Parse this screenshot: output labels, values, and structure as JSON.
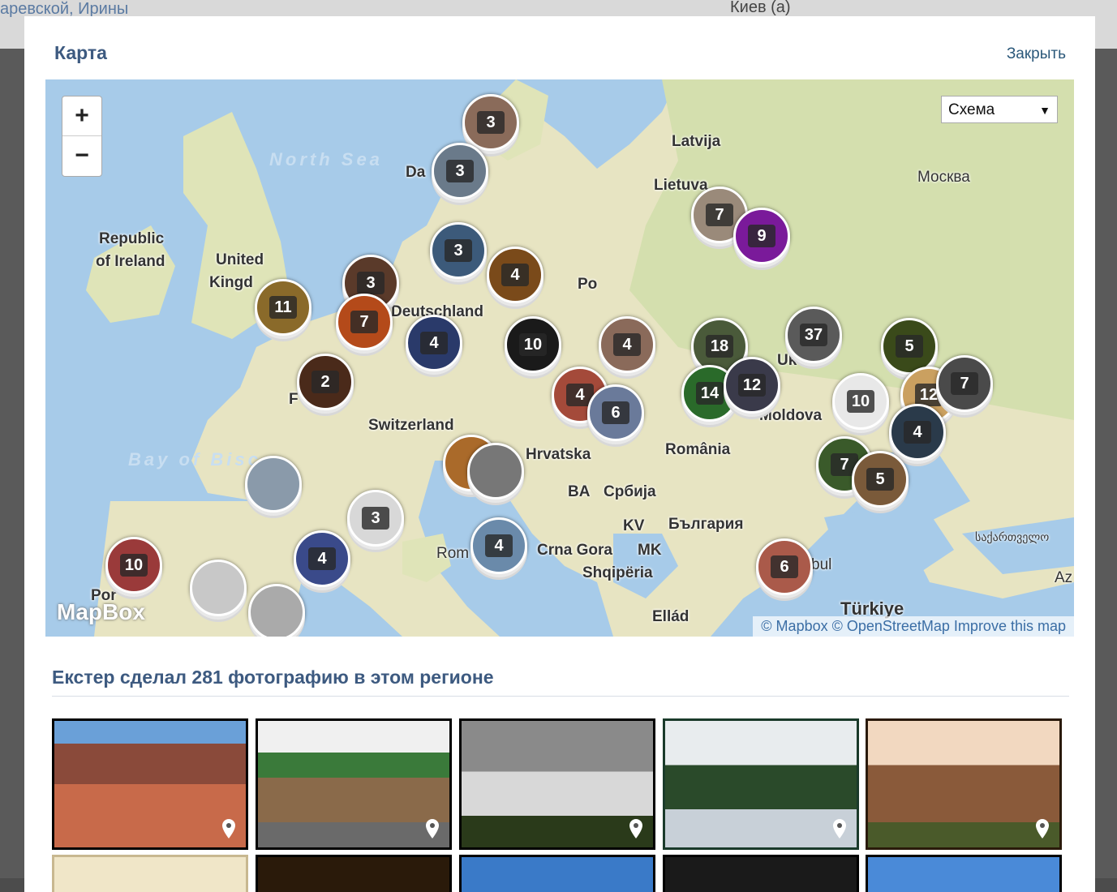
{
  "background": {
    "left_text": "аревской, Ирины",
    "right_text": "Киев (а)"
  },
  "modal": {
    "title": "Карта",
    "close_label": "Закрыть"
  },
  "map": {
    "zoom_in": "+",
    "zoom_out": "−",
    "layer_select": "Схема",
    "labels": [
      "Latvija",
      "Lietuva",
      "Москва",
      "Republic",
      "of Ireland",
      "United",
      "Kingd",
      "Deutschland",
      "Po",
      "Switzerland",
      "Hrvatska",
      "România",
      "BA",
      "Србија",
      "KV",
      "България",
      "Crna Gora",
      "MK",
      "Shqipëria",
      "Ellád",
      "Türkiye",
      "Moldova",
      "Uk",
      "Da",
      "Rom",
      "F",
      "Por",
      "bul",
      "საქართველო",
      "Az"
    ],
    "sea_labels": [
      "North Sea",
      "Bay of Bisc"
    ],
    "clusters": [
      "3",
      "3",
      "3",
      "3",
      "4",
      "11",
      "7",
      "4",
      "2",
      "10",
      "4",
      "4",
      "6",
      "7",
      "9",
      "18",
      "14",
      "12",
      "37",
      "5",
      "10",
      "12",
      "7",
      "4",
      "7",
      "5",
      "3",
      "4",
      "4",
      "10",
      "6"
    ],
    "attribution": "© Mapbox © OpenStreetMap Improve this map",
    "logo": "MapBox"
  },
  "gallery": {
    "heading": "Екстер сделал 281 фотографию в этом регионе"
  }
}
